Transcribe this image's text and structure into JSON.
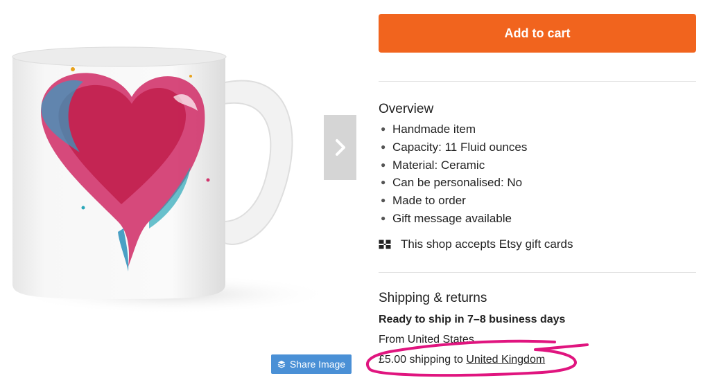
{
  "product_image": {
    "alt": "White ceramic mug with watercolor heart",
    "share_label": "Share Image"
  },
  "actions": {
    "add_to_cart_label": "Add to cart"
  },
  "overview": {
    "title": "Overview",
    "items": [
      "Handmade item",
      "Capacity: 11 Fluid ounces",
      "Material: Ceramic",
      "Can be personalised: No",
      "Made to order",
      "Gift message available"
    ],
    "gift_card_text": "This shop accepts Etsy gift cards"
  },
  "shipping": {
    "title": "Shipping & returns",
    "ready_text": "Ready to ship in 7–8 business days",
    "origin_text": "From United States",
    "cost_prefix": "£5.00 shipping to ",
    "country": "United Kingdom"
  },
  "colors": {
    "cta": "#f1641e",
    "share": "#4a90d6",
    "annotation": "#e0157f"
  },
  "icons": {
    "next": "chevron-right-icon",
    "share": "layers-icon",
    "gift_card": "gift-card-icon"
  }
}
